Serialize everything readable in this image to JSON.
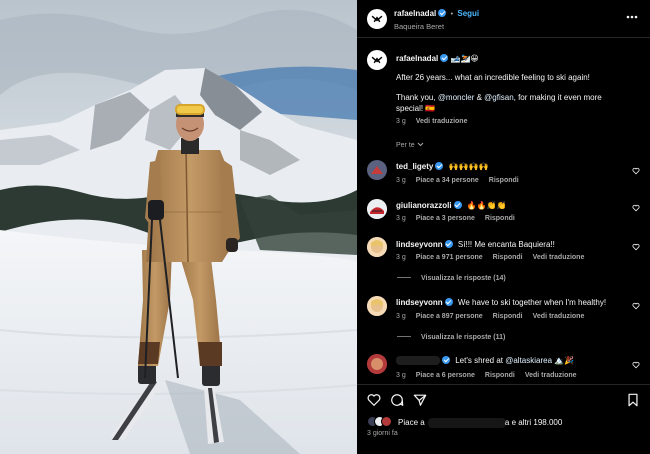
{
  "header": {
    "username": "rafaelnadal",
    "separator": "•",
    "follow_label": "Segui",
    "location": "Baqueira Beret",
    "more_icon": "more-dots-icon"
  },
  "caption": {
    "username": "rafaelnadal",
    "emojis": "🎿⛷️😀",
    "line1": "After 26 years... what an incredible feeling to ski again!",
    "line2_pre": "Thank you, ",
    "mention1": "@moncler",
    "amp": " & ",
    "mention2": "@gfisan",
    "line2_post": ", for making it even more",
    "line3": "special! 🇪🇸",
    "time": "3 g",
    "translate": "Vedi traduzione"
  },
  "filter_label": "Per te",
  "comments": [
    {
      "username": "ted_ligety",
      "text": "🙌🙌🙌🙌",
      "time": "3 g",
      "likes": "Piace a 34 persone",
      "reply": "Rispondi"
    },
    {
      "username": "giulianorazzoli",
      "text": "🔥🔥👏👏",
      "time": "3 g",
      "likes": "Piace a 3 persone",
      "reply": "Rispondi"
    },
    {
      "username": "lindseyvonn",
      "text": "Sí!!! Me encanta Baquiera!!",
      "time": "3 g",
      "likes": "Piace a 971 persone",
      "reply": "Rispondi",
      "translate": "Vedi traduzione",
      "view_replies": "Visualizza le risposte (14)"
    },
    {
      "username": "lindseyvonn",
      "text": "We have to ski together when I'm healthy!",
      "time": "3 g",
      "likes": "Piace a 897 persone",
      "reply": "Rispondi",
      "translate": "Vedi traduzione",
      "view_replies": "Visualizza le risposte (11)"
    },
    {
      "username": "",
      "text_pre": "Let's shred at ",
      "mention": "@altaskiarea",
      "text_post": " 🏔️🎉",
      "time": "3 g",
      "likes": "Piace a 6 persone",
      "reply": "Rispondi",
      "translate": "Vedi traduzione"
    }
  ],
  "likes_line": {
    "pre": "Piace a",
    "post": "a e altri 198.000"
  },
  "post_time": "3 giorni fa",
  "colors": {
    "link": "#4cb5f9",
    "verified": "#3897f0",
    "background": "#000000"
  }
}
